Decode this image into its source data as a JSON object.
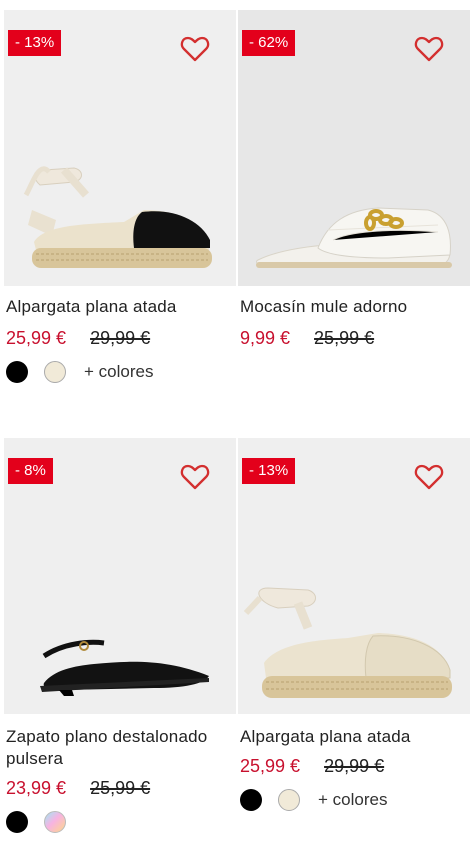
{
  "products": [
    {
      "discount": "- 13%",
      "title": "Alpargata plana atada",
      "price": "25,99 €",
      "old_price": "29,99 €",
      "more_colors": "+ colores",
      "swatches": [
        "black",
        "beige"
      ]
    },
    {
      "discount": "- 62%",
      "title": "Mocasín mule adorno",
      "price": "9,99 €",
      "old_price": "25,99 €",
      "more_colors": "",
      "swatches": []
    },
    {
      "discount": "- 8%",
      "title": "Zapato plano destalonado pulsera",
      "price": "23,99 €",
      "old_price": "25,99 €",
      "more_colors": "",
      "swatches": [
        "black",
        "iridescent"
      ]
    },
    {
      "discount": "- 13%",
      "title": "Alpargata plana atada",
      "price": "25,99 €",
      "old_price": "29,99 €",
      "more_colors": "+ colores",
      "swatches": [
        "black",
        "beige"
      ]
    }
  ],
  "colors": {
    "accent": "#e3001b",
    "price": "#c8102e",
    "heart": "#d32f2f"
  },
  "icons": {
    "wishlist": "heart-outline-icon"
  }
}
